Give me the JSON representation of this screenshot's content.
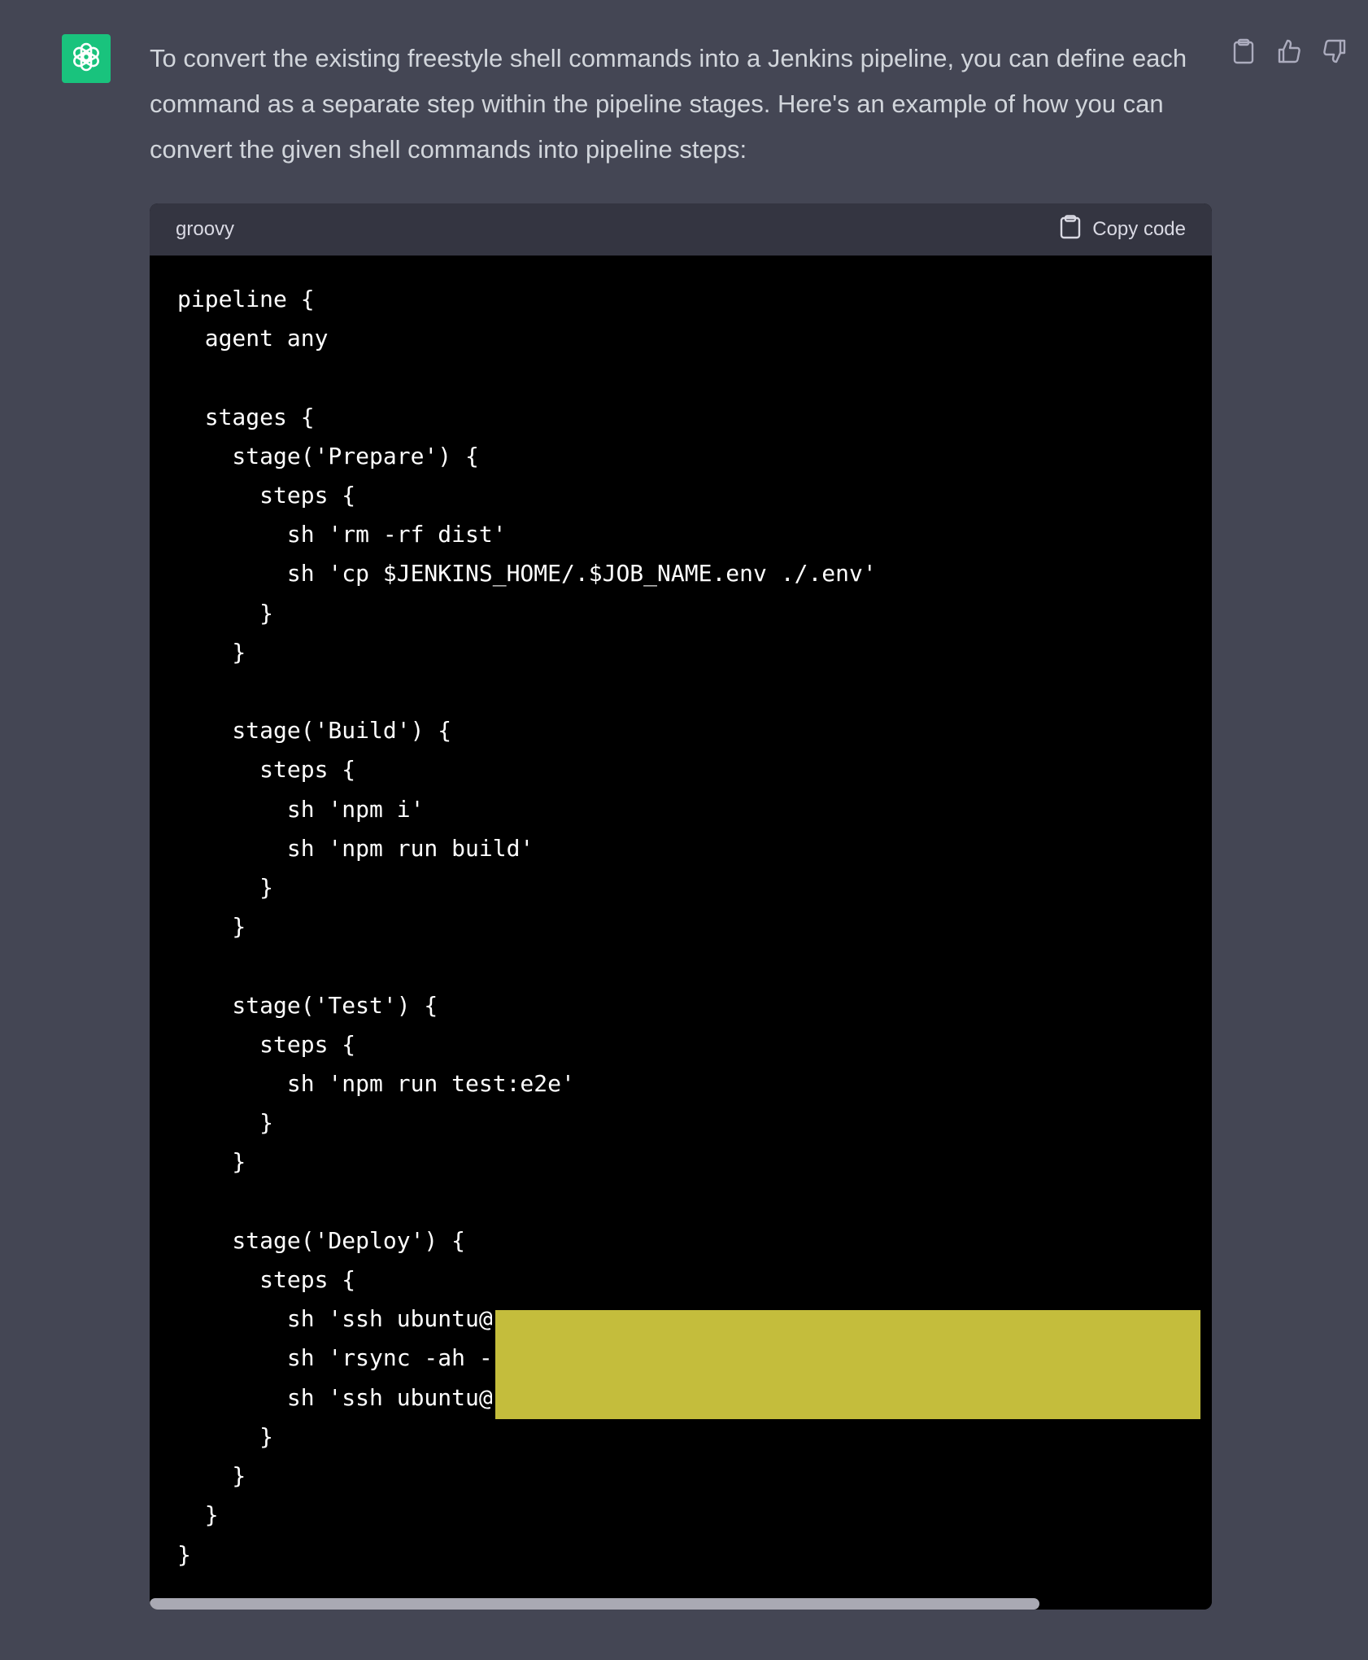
{
  "assistant": {
    "avatar_icon": "openai-logo-icon",
    "avatar_color": "#19c37d"
  },
  "message": {
    "text": "To convert the existing freestyle shell commands into a Jenkins pipeline, you can define each command as a separate step within the pipeline stages. Here's an example of how you can convert the given shell commands into pipeline steps:"
  },
  "actions": {
    "copy_icon": "clipboard-icon",
    "like_icon": "thumbs-up-icon",
    "dislike_icon": "thumbs-down-icon"
  },
  "code_block": {
    "language": "groovy",
    "copy_label": "Copy code",
    "code": "pipeline {\n  agent any\n\n  stages {\n    stage('Prepare') {\n      steps {\n        sh 'rm -rf dist'\n        sh 'cp $JENKINS_HOME/.$JOB_NAME.env ./.env'\n      }\n    }\n\n    stage('Build') {\n      steps {\n        sh 'npm i'\n        sh 'npm run build'\n      }\n    }\n\n    stage('Test') {\n      steps {\n        sh 'npm run test:e2e'\n      }\n    }\n\n    stage('Deploy') {\n      steps {\n        sh 'ssh ubuntu@\n        sh 'rsync -ah -\n        sh 'ssh ubuntu@\n      }\n    }\n  }\n}",
    "redaction_color": "#c4bd3c"
  }
}
